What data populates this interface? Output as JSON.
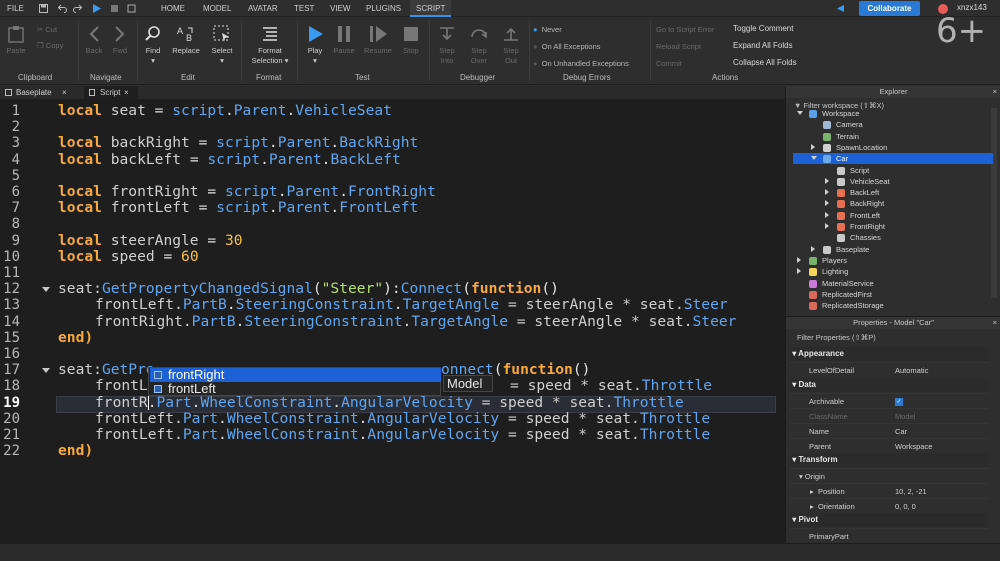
{
  "menubar": {
    "file": "FILE",
    "tabs": [
      "HOME",
      "MODEL",
      "AVATAR",
      "TEST",
      "VIEW",
      "PLUGINS",
      "SCRIPT"
    ],
    "collaborate": "Collaborate",
    "username": "xnzx143",
    "watermark": "6+"
  },
  "ribbon": {
    "clipboard": {
      "paste": "Paste",
      "cut": "Cut",
      "copy": "Copy",
      "label": "Clipboard"
    },
    "navigate": {
      "back": "Back",
      "fwd": "Fwd",
      "label": "Navigate"
    },
    "edit": {
      "find": "Find",
      "replace": "Replace",
      "select": "Select",
      "label": "Edit"
    },
    "format": {
      "format_selection_1": "Format",
      "format_selection_2": "Selection",
      "label": "Format"
    },
    "test": {
      "play": "Play",
      "pause": "Pause",
      "resume": "Resume",
      "stop": "Stop",
      "label": "Test"
    },
    "debugger": {
      "step_into_1": "Step",
      "step_into_2": "Into",
      "step_over_1": "Step",
      "step_over_2": "Over",
      "step_out_1": "Step",
      "step_out_2": "Out",
      "label": "Debugger"
    },
    "debug_errors": {
      "never": "Never",
      "on_all": "On All Exceptions",
      "on_unhandled": "On Unhandled Exceptions",
      "label": "Debug Errors"
    },
    "actions": {
      "go_to_error": "Go to Script Error",
      "reload": "Reload Script",
      "commit": "Commit",
      "toggle_comment": "Toggle Comment",
      "expand_all": "Expand All Folds",
      "collapse_all": "Collapse All Folds",
      "label": "Actions"
    }
  },
  "tabs": {
    "baseplate": "Baseplate",
    "script": "Script"
  },
  "editor": {
    "line_numbers": [
      "1",
      "2",
      "3",
      "4",
      "5",
      "6",
      "7",
      "8",
      "9",
      "10",
      "11",
      "12",
      "13",
      "14",
      "15",
      "16",
      "17",
      "18",
      "19",
      "20",
      "21",
      "22"
    ],
    "current_line": "19",
    "lines": {
      "l1": [
        "local",
        " seat ",
        "=",
        " script",
        ".",
        "Parent",
        ".",
        "VehicleSeat"
      ],
      "l3": [
        "local",
        " backRight ",
        "=",
        " script",
        ".",
        "Parent",
        ".",
        "BackRight"
      ],
      "l4": [
        "local",
        " backLeft ",
        "=",
        " script",
        ".",
        "Parent",
        ".",
        "BackLeft"
      ],
      "l6": [
        "local",
        " frontRight ",
        "=",
        " script",
        ".",
        "Parent",
        ".",
        "FrontRight"
      ],
      "l7": [
        "local",
        " frontLeft ",
        "=",
        " script",
        ".",
        "Parent",
        ".",
        "FrontLeft"
      ],
      "l9": [
        "local",
        " steerAngle ",
        "= ",
        "30"
      ],
      "l10": [
        "local",
        " speed ",
        "= ",
        "60"
      ],
      "l12": [
        "seat:",
        "GetPropertyChangedSignal",
        "(",
        "\"Steer\"",
        "):",
        "Connect",
        "(",
        "function",
        "()"
      ],
      "l13": [
        "frontLeft.",
        "PartB",
        ".",
        "SteeringConstraint",
        ".",
        "TargetAngle",
        " = steerAngle * seat.",
        "Steer"
      ],
      "l14": [
        "frontRight.",
        "PartB",
        ".",
        "SteeringConstraint",
        ".",
        "TargetAngle",
        " = steerAngle * seat.",
        "Steer"
      ],
      "l15": [
        "end)"
      ],
      "l17a": [
        "seat:",
        "GetPro"
      ],
      "l17b": [
        "onnect",
        "(",
        "function",
        "()"
      ],
      "l18a": [
        "frontL"
      ],
      "l18b": [
        "= speed * seat.",
        "Throttle"
      ],
      "l19": [
        "frontR",
        ".",
        "Part",
        ".",
        "WheelConstraint",
        ".",
        "AngularVelocity",
        " = speed * seat.",
        "Throttle"
      ],
      "l20": [
        "frontLeft.",
        "Part",
        ".",
        "WheelConstraint",
        ".",
        "AngularVelocity",
        " = speed * seat.",
        "Throttle"
      ],
      "l21": [
        "frontLeft.",
        "Part",
        ".",
        "WheelConstraint",
        ".",
        "AngularVelocity",
        " = speed * seat.",
        "Throttle"
      ],
      "l22": [
        "end)"
      ]
    },
    "autocomplete": {
      "items": [
        "frontRight",
        "frontLeft"
      ],
      "detail": "Model"
    }
  },
  "explorer": {
    "title": "Explorer",
    "filter": "Filter workspace (⇧⌘X)",
    "items": [
      {
        "label": "Workspace"
      },
      {
        "label": "Camera"
      },
      {
        "label": "Terrain"
      },
      {
        "label": "SpawnLocation"
      },
      {
        "label": "Car"
      },
      {
        "label": "Script"
      },
      {
        "label": "VehicleSeat"
      },
      {
        "label": "BackLeft"
      },
      {
        "label": "BackRight"
      },
      {
        "label": "FrontLeft"
      },
      {
        "label": "FrontRight"
      },
      {
        "label": "Chassies"
      },
      {
        "label": "Baseplate"
      },
      {
        "label": "Players"
      },
      {
        "label": "Lighting"
      },
      {
        "label": "MaterialService"
      },
      {
        "label": "ReplicatedFirst"
      },
      {
        "label": "ReplicatedStorage"
      }
    ]
  },
  "properties": {
    "title": "Properties - Model \"Car\"",
    "filter": "Filter Properties (⇧⌘P)",
    "sections": {
      "appearance": "Appearance",
      "data": "Data",
      "transform": "Transform",
      "pivot": "Pivot"
    },
    "rows": {
      "lod": {
        "name": "LevelOfDetail",
        "value": "Automatic"
      },
      "archivable": {
        "name": "Archivable",
        "value": "✓"
      },
      "classname": {
        "name": "ClassName",
        "value": "Model"
      },
      "name": {
        "name": "Name",
        "value": "Car"
      },
      "parent": {
        "name": "Parent",
        "value": "Workspace"
      },
      "origin": {
        "name": "Origin",
        "value": ""
      },
      "position": {
        "name": "Position",
        "value": "10, 2, -21"
      },
      "orientation": {
        "name": "Orientation",
        "value": "0, 0, 0"
      },
      "primarypart": {
        "name": "PrimaryPart",
        "value": ""
      }
    }
  },
  "colors": {
    "accent": "#1c62d6",
    "collaborate": "#2a7ad5",
    "keyword": "#f7a93b",
    "member": "#5ea6f0",
    "number": "#f7c242",
    "string": "#b7e06b"
  }
}
